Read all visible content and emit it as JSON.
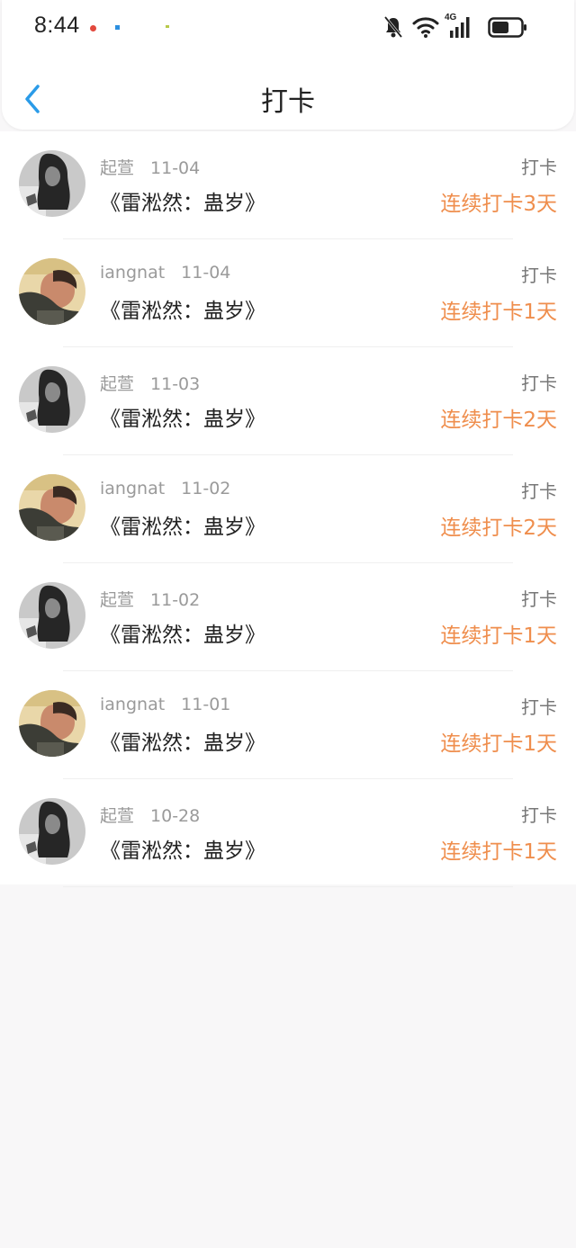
{
  "status_bar": {
    "time": "8:44",
    "network_label": "4G",
    "icons": [
      "notification-red-icon",
      "notification-blue-icon",
      "notification-green-icon",
      "bell-off-icon",
      "wifi-icon",
      "cellular-4g-icon",
      "battery-icon"
    ]
  },
  "header": {
    "title": "打卡",
    "back_icon": "chevron-left-icon"
  },
  "colors": {
    "accent_blue": "#2a9be8",
    "streak_orange": "#ef8e4d",
    "meta_gray": "#9a9a9a",
    "background": "#f8f7f8"
  },
  "records": [
    {
      "user": "起萱",
      "date": "11-04",
      "book": "《雷淞然：蛊岁》",
      "action": "打卡",
      "streak": "连续打卡3天",
      "avatar": "avatar-girl-bw"
    },
    {
      "user": "iangnat",
      "date": "11-04",
      "book": "《雷淞然：蛊岁》",
      "action": "打卡",
      "streak": "连续打卡1天",
      "avatar": "avatar-face-warm"
    },
    {
      "user": "起萱",
      "date": "11-03",
      "book": "《雷淞然：蛊岁》",
      "action": "打卡",
      "streak": "连续打卡2天",
      "avatar": "avatar-girl-bw"
    },
    {
      "user": "iangnat",
      "date": "11-02",
      "book": "《雷淞然：蛊岁》",
      "action": "打卡",
      "streak": "连续打卡2天",
      "avatar": "avatar-face-warm"
    },
    {
      "user": "起萱",
      "date": "11-02",
      "book": "《雷淞然：蛊岁》",
      "action": "打卡",
      "streak": "连续打卡1天",
      "avatar": "avatar-girl-bw"
    },
    {
      "user": "iangnat",
      "date": "11-01",
      "book": "《雷淞然：蛊岁》",
      "action": "打卡",
      "streak": "连续打卡1天",
      "avatar": "avatar-face-warm"
    },
    {
      "user": "起萱",
      "date": "10-28",
      "book": "《雷淞然：蛊岁》",
      "action": "打卡",
      "streak": "连续打卡1天",
      "avatar": "avatar-girl-bw"
    }
  ]
}
